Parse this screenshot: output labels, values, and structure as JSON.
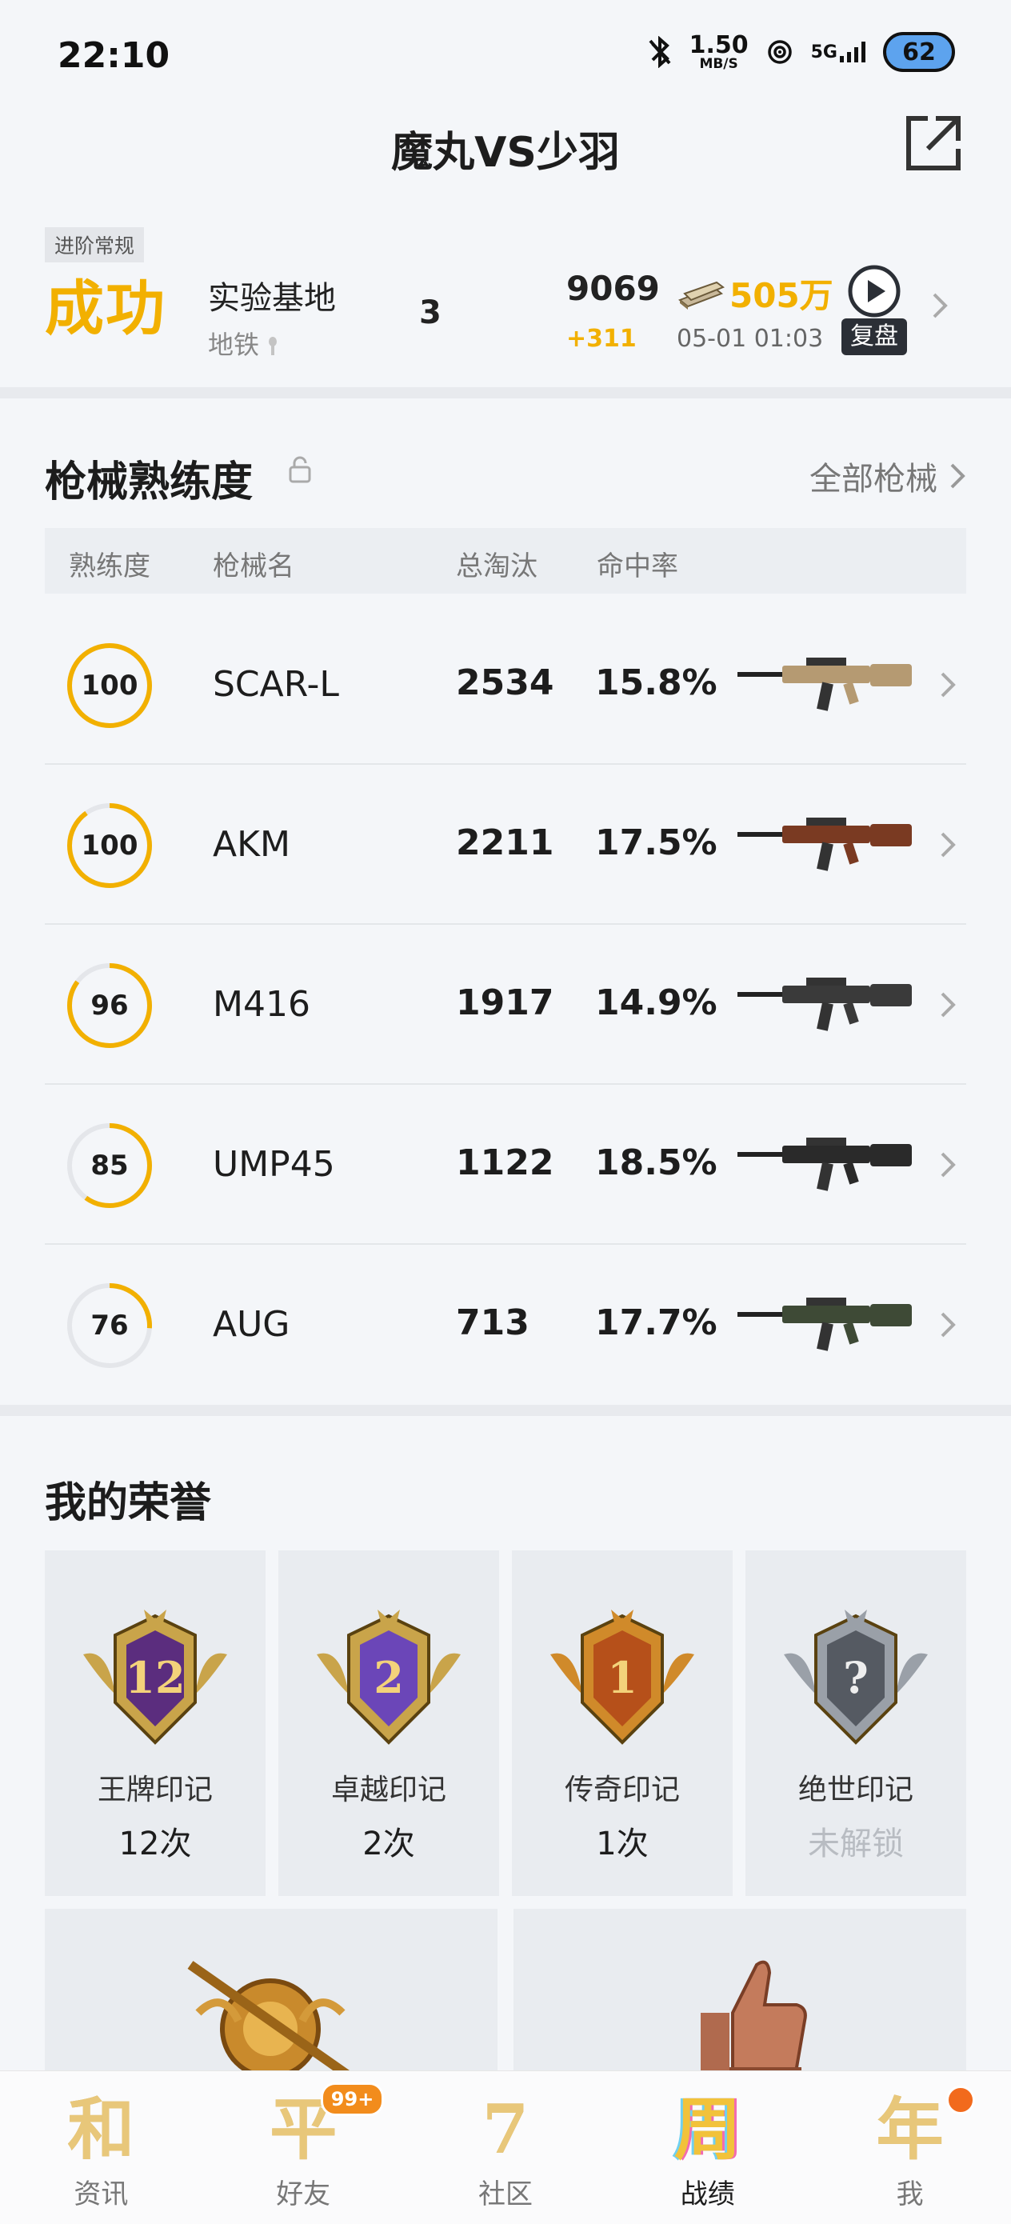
{
  "status_bar": {
    "time": "22:10",
    "net_speed": "1.50",
    "net_unit": "MB/S",
    "signal": "5G",
    "battery": "62"
  },
  "header": {
    "title": "魔丸VS少羽"
  },
  "match": {
    "mode": "进阶常规",
    "result": "成功",
    "map": "实验基地",
    "sub_map": "地铁",
    "kills": "3",
    "score": "9069",
    "score_delta": "+311",
    "coins": "505万",
    "time": "05-01 01:03",
    "replay_label": "复盘"
  },
  "weapons": {
    "title": "枪械熟练度",
    "all_link": "全部枪械",
    "headers": {
      "proficiency": "熟练度",
      "name": "枪械名",
      "kills": "总淘汰",
      "hit_rate": "命中率"
    },
    "rows": [
      {
        "proficiency": "100",
        "name": "SCAR-L",
        "kills": "2534",
        "hit_rate": "15.8%",
        "ring_fill": 1.0,
        "gun_color": "#b59a72"
      },
      {
        "proficiency": "100",
        "name": "AKM",
        "kills": "2211",
        "hit_rate": "17.5%",
        "ring_fill": 0.9,
        "gun_color": "#7a3a22"
      },
      {
        "proficiency": "96",
        "name": "M416",
        "kills": "1917",
        "hit_rate": "14.9%",
        "ring_fill": 0.85,
        "gun_color": "#3a3a3a"
      },
      {
        "proficiency": "85",
        "name": "UMP45",
        "kills": "1122",
        "hit_rate": "18.5%",
        "ring_fill": 0.6,
        "gun_color": "#2a2a2a"
      },
      {
        "proficiency": "76",
        "name": "AUG",
        "kills": "713",
        "hit_rate": "17.7%",
        "ring_fill": 0.26,
        "gun_color": "#3e4a36"
      }
    ]
  },
  "honors": {
    "title": "我的荣誉",
    "items": [
      {
        "name": "王牌印记",
        "count": "12次",
        "badge_number": "12",
        "locked": false
      },
      {
        "name": "卓越印记",
        "count": "2次",
        "badge_number": "2",
        "locked": false
      },
      {
        "name": "传奇印记",
        "count": "1次",
        "badge_number": "1",
        "locked": false
      },
      {
        "name": "绝世印记",
        "count": "未解锁",
        "badge_number": "?",
        "locked": true
      }
    ]
  },
  "bottom_nav": {
    "items": [
      {
        "glyph": "和",
        "label": "资讯",
        "active": false
      },
      {
        "glyph": "平",
        "label": "好友",
        "active": false,
        "badge": "99+"
      },
      {
        "glyph": "7",
        "label": "社区",
        "active": false
      },
      {
        "glyph": "周",
        "label": "战绩",
        "active": true
      },
      {
        "glyph": "年",
        "label": "我",
        "active": false
      }
    ]
  },
  "colors": {
    "accent": "#f2b000",
    "background": "#f4f6f9"
  }
}
